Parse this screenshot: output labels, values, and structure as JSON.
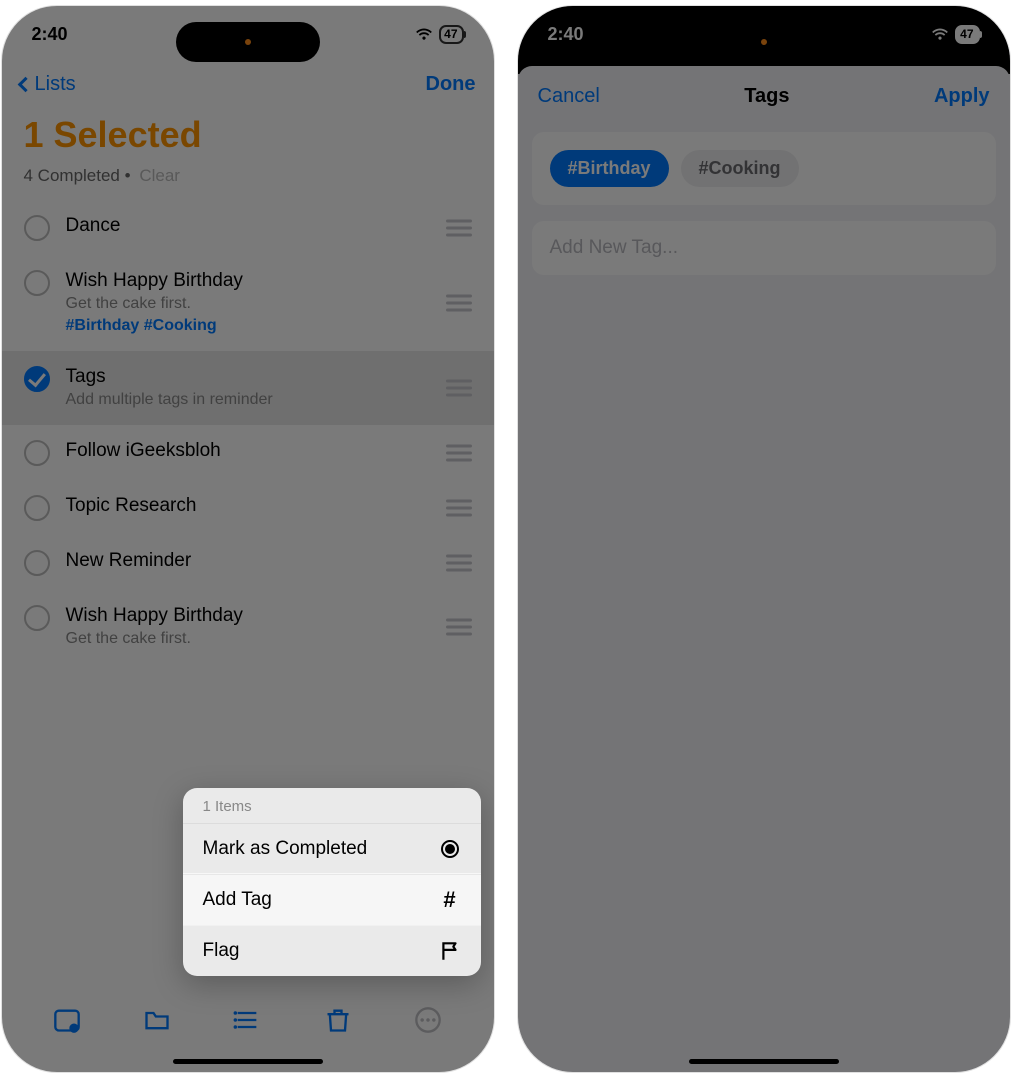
{
  "status": {
    "time": "2:40",
    "battery": "47"
  },
  "left": {
    "nav_back": "Lists",
    "nav_done": "Done",
    "title": "1 Selected",
    "completed_text": "4 Completed",
    "clear_text": "Clear",
    "reminders": [
      {
        "title": "Dance",
        "note": "",
        "tags": "",
        "selected": false
      },
      {
        "title": "Wish Happy Birthday",
        "note": "Get the cake first.",
        "tags": "#Birthday #Cooking",
        "selected": false
      },
      {
        "title": "Tags",
        "note": "Add multiple tags in reminder",
        "tags": "",
        "selected": true
      },
      {
        "title": "Follow iGeeksbloh",
        "note": "",
        "tags": "",
        "selected": false
      },
      {
        "title": "Topic Research",
        "note": "",
        "tags": "",
        "selected": false
      },
      {
        "title": "New Reminder",
        "note": "",
        "tags": "",
        "selected": false
      },
      {
        "title": "Wish Happy Birthday",
        "note": "Get the cake first.",
        "tags": "",
        "selected": false
      }
    ],
    "menu": {
      "header": "1 Items",
      "mark": "Mark as Completed",
      "add_tag": "Add Tag",
      "flag": "Flag"
    }
  },
  "right": {
    "cancel": "Cancel",
    "title": "Tags",
    "apply": "Apply",
    "tags": [
      {
        "label": "#Birthday",
        "on": true
      },
      {
        "label": "#Cooking",
        "on": false
      }
    ],
    "new_tag_placeholder": "Add New Tag..."
  }
}
